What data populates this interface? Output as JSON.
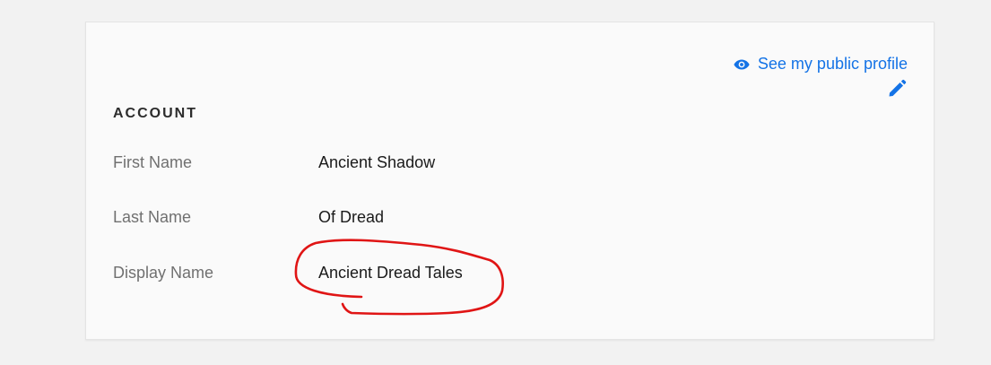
{
  "account": {
    "public_profile_link": "See my public profile",
    "section_title": "ACCOUNT",
    "fields": [
      {
        "label": "First Name",
        "value": "Ancient Shadow"
      },
      {
        "label": "Last Name",
        "value": "Of Dread"
      },
      {
        "label": "Display Name",
        "value": "Ancient Dread Tales"
      }
    ]
  },
  "icons": {
    "link_icon": "eye-icon",
    "edit_icon": "pencil-icon"
  },
  "colors": {
    "page_background": "#f2f2f2",
    "card_background": "#fafafa",
    "accent_blue": "#1473e6",
    "label_gray": "#707070",
    "annotation_red": "#e01515"
  },
  "annotation": {
    "kind": "hand-drawn red circle around Display Name value"
  }
}
